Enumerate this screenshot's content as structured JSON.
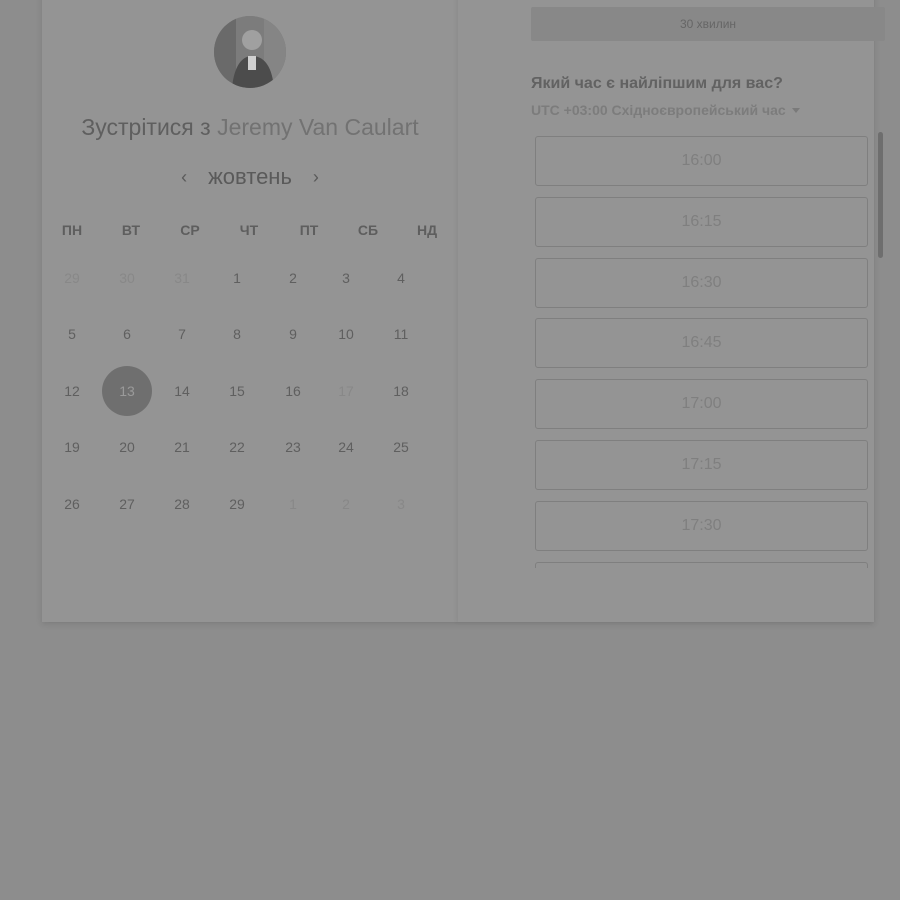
{
  "header": {
    "title_prefix": "Зустрітися з",
    "host_name": "Jeremy Van Caulart"
  },
  "calendar": {
    "month": "жовтень",
    "weekdays": [
      "ПН",
      "ВТ",
      "СР",
      "ЧТ",
      "ПТ",
      "СБ",
      "НД"
    ],
    "weeks": [
      [
        {
          "d": "29",
          "m": true
        },
        {
          "d": "30",
          "m": true
        },
        {
          "d": "31",
          "m": true
        },
        {
          "d": "1"
        },
        {
          "d": "2"
        },
        {
          "d": "3"
        },
        {
          "d": "4"
        }
      ],
      [
        {
          "d": "5"
        },
        {
          "d": "6"
        },
        {
          "d": "7"
        },
        {
          "d": "8"
        },
        {
          "d": "9"
        },
        {
          "d": "10"
        },
        {
          "d": "11"
        }
      ],
      [
        {
          "d": "12"
        },
        {
          "d": "13",
          "sel": true
        },
        {
          "d": "14"
        },
        {
          "d": "15"
        },
        {
          "d": "16"
        },
        {
          "d": "17",
          "m": true
        },
        {
          "d": "18"
        }
      ],
      [
        {
          "d": "19"
        },
        {
          "d": "20"
        },
        {
          "d": "21"
        },
        {
          "d": "22"
        },
        {
          "d": "23"
        },
        {
          "d": "24"
        },
        {
          "d": "25"
        }
      ],
      [
        {
          "d": "26"
        },
        {
          "d": "27"
        },
        {
          "d": "28"
        },
        {
          "d": "29"
        },
        {
          "d": "1",
          "m": true
        },
        {
          "d": "2",
          "m": true
        },
        {
          "d": "3",
          "m": true
        }
      ]
    ]
  },
  "booking": {
    "duration": "30 хвилин",
    "question": "Який час є найліпшим для вас?",
    "timezone": "UTC +03:00 Східноєвропейський час",
    "slots": [
      "16:00",
      "16:15",
      "16:30",
      "16:45",
      "17:00",
      "17:15",
      "17:30",
      ""
    ]
  }
}
